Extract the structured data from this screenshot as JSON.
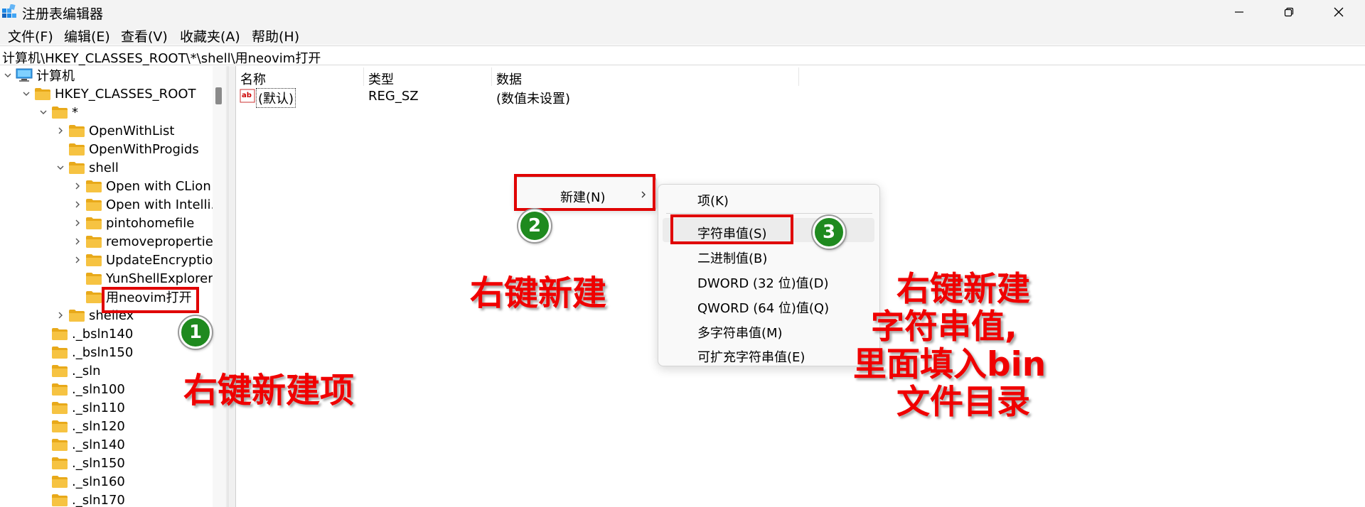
{
  "window": {
    "title": "注册表编辑器"
  },
  "menubar": {
    "items": [
      "文件(F)",
      "编辑(E)",
      "查看(V)",
      "收藏夹(A)",
      "帮助(H)"
    ]
  },
  "address": {
    "path": "计算机\\HKEY_CLASSES_ROOT\\*\\shell\\用neovim打开"
  },
  "tree": {
    "items": [
      {
        "label": "计算机",
        "icon": "computer-icon",
        "expanded": true
      },
      {
        "label": "HKEY_CLASSES_ROOT",
        "icon": "folder-icon",
        "expanded": true
      },
      {
        "label": "*",
        "icon": "folder-icon",
        "expanded": true
      },
      {
        "label": "OpenWithList",
        "icon": "folder-icon",
        "expanded": false
      },
      {
        "label": "OpenWithProgids",
        "icon": "folder-icon"
      },
      {
        "label": "shell",
        "icon": "folder-icon",
        "expanded": true
      },
      {
        "label": "Open with CLion",
        "icon": "folder-icon",
        "expanded": false
      },
      {
        "label": "Open with Intelli.",
        "icon": "folder-icon",
        "expanded": false
      },
      {
        "label": "pintohomefile",
        "icon": "folder-icon",
        "expanded": false
      },
      {
        "label": "removepropertie",
        "icon": "folder-icon",
        "expanded": false
      },
      {
        "label": "UpdateEncryptio",
        "icon": "folder-icon",
        "expanded": false
      },
      {
        "label": "YunShellExplorer",
        "icon": "folder-icon"
      },
      {
        "label": "用neovim打开",
        "icon": "folder-icon",
        "selected": true
      },
      {
        "label": "shellex",
        "icon": "folder-icon",
        "expanded": false
      },
      {
        "label": "._bsln140",
        "icon": "folder-icon"
      },
      {
        "label": "._bsln150",
        "icon": "folder-icon"
      },
      {
        "label": "._sln",
        "icon": "folder-icon"
      },
      {
        "label": "._sln100",
        "icon": "folder-icon"
      },
      {
        "label": "._sln110",
        "icon": "folder-icon"
      },
      {
        "label": "._sln120",
        "icon": "folder-icon"
      },
      {
        "label": "._sln140",
        "icon": "folder-icon"
      },
      {
        "label": "._sln150",
        "icon": "folder-icon"
      },
      {
        "label": "._sln160",
        "icon": "folder-icon"
      },
      {
        "label": "._sln170",
        "icon": "folder-icon"
      }
    ]
  },
  "list": {
    "columns": [
      "名称",
      "类型",
      "数据"
    ],
    "rows": [
      {
        "name": "(默认)",
        "type": "REG_SZ",
        "data": "(数值未设置)",
        "icon": "string-value-icon"
      }
    ]
  },
  "context_menu": {
    "new_label": "新建(N)",
    "submenu": [
      "项(K)",
      "字符串值(S)",
      "二进制值(B)",
      "DWORD (32 位)值(D)",
      "QWORD (64 位)值(Q)",
      "多字符串值(M)",
      "可扩充字符串值(E)"
    ]
  },
  "annotations": {
    "badges": [
      "1",
      "2",
      "3"
    ],
    "note1": "右键新建项",
    "note2": "右键新建",
    "note3": [
      "右键新建",
      "字符串值,",
      "里面填入bin",
      "文件目录"
    ]
  },
  "colors": {
    "annotation_red": "#e00000",
    "badge_green": "#1f8a1f",
    "folder_yellow": "#f6c342"
  }
}
